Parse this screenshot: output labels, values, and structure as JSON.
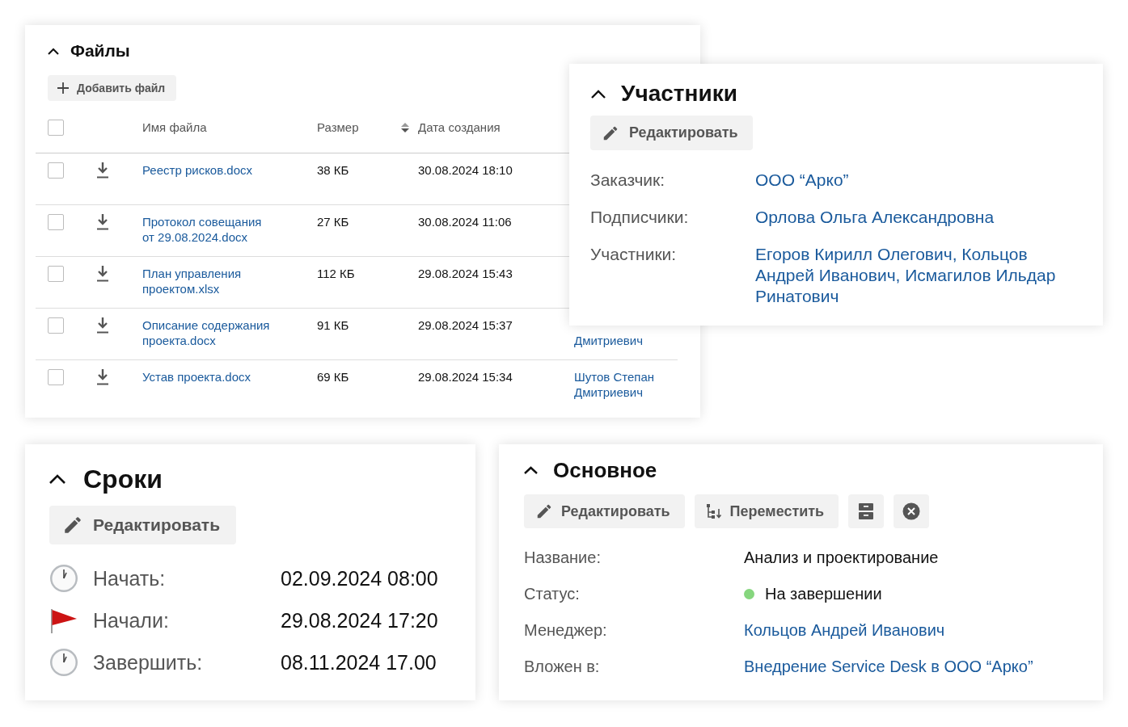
{
  "files": {
    "title": "Файлы",
    "add_button": "Добавить файл",
    "select_all_checked": false,
    "columns": [
      "Имя файла",
      "Размер",
      "Дата создания"
    ],
    "rows": [
      {
        "checked": false,
        "name": "Реестр рисков.docx",
        "size": "38 КБ",
        "date": "30.08.2024 18:10"
      },
      {
        "checked": false,
        "name": "Протокол совещания от 29.08.2024.docx",
        "size": "27 КБ",
        "date": "30.08.2024 11:06"
      },
      {
        "checked": false,
        "name": "План управления проектом.xlsx",
        "size": "112 КБ",
        "date": "29.08.2024 15:43"
      },
      {
        "checked": false,
        "name": "Описание содержания проекта.docx",
        "size": "91 КБ",
        "date": "29.08.2024 15:37",
        "author": "Дмитриевич",
        "author_first_line_hidden": true
      },
      {
        "checked": false,
        "name": "Устав проекта.docx",
        "size": "69 КБ",
        "date": "29.08.2024 15:34",
        "author": "Шутов Степан Дмитриевич"
      }
    ]
  },
  "participants": {
    "title": "Участники",
    "edit_button": "Редактировать",
    "fields": [
      {
        "label": "Заказчик:",
        "value": "ООО “Арко”"
      },
      {
        "label": "Подписчики:",
        "value": "Орлова Ольга Александровна"
      },
      {
        "label": "Участники:",
        "value": "Егоров Кирилл Олегович, Кольцов Андрей Иванович, Исмагилов Ильдар Ринатович"
      }
    ]
  },
  "deadlines": {
    "title": "Сроки",
    "edit_button": "Редактировать",
    "items": [
      {
        "kind": "clock",
        "label": "Начать:",
        "value": "02.09.2024 08:00"
      },
      {
        "kind": "flag",
        "label": "Начали:",
        "value": "29.08.2024 17:20"
      },
      {
        "kind": "clock",
        "label": "Завершить:",
        "value": "08.11.2024 17.00"
      }
    ]
  },
  "main": {
    "title": "Основное",
    "buttons": [
      {
        "kind": "edit",
        "label": "Редактировать"
      },
      {
        "kind": "move",
        "label": "Переместить"
      },
      {
        "kind": "archive"
      },
      {
        "kind": "cancel"
      }
    ],
    "fields": [
      {
        "kind": "text",
        "label": "Название:",
        "value": "Анализ и проектирование"
      },
      {
        "kind": "status",
        "label": "Статус:",
        "value": "На завершении",
        "color": "#86d67e"
      },
      {
        "kind": "link",
        "label": "Менеджер:",
        "value": "Кольцов Андрей Иванович"
      },
      {
        "kind": "link",
        "label": "Вложен в:",
        "value": "Внедрение Service Desk в ООО “Арко”"
      }
    ]
  }
}
